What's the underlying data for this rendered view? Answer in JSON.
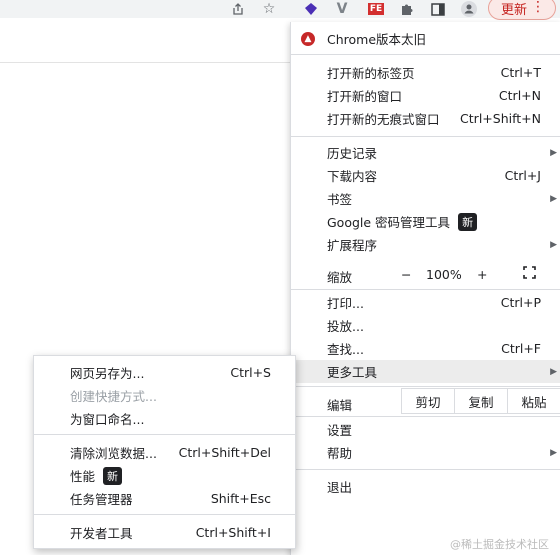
{
  "toolbar": {
    "share_icon": "share-icon",
    "star_icon": "bookmark-star-icon",
    "ext_icons": [
      "extension-purple-diamond-icon",
      "extension-v-icon",
      "extension-fe-icon",
      "extensions-puzzle-icon",
      "side-panel-icon",
      "profile-avatar-icon"
    ],
    "fe_text": "FE",
    "update_label": "更新",
    "menu_icon": "⋮"
  },
  "menu": {
    "chrome_old": "Chrome版本太旧",
    "new_tab": "打开新的标签页",
    "new_tab_sc": "Ctrl+T",
    "new_window": "打开新的窗口",
    "new_window_sc": "Ctrl+N",
    "incognito": "打开新的无痕式窗口",
    "incognito_sc": "Ctrl+Shift+N",
    "history": "历史记录",
    "downloads": "下载内容",
    "downloads_sc": "Ctrl+J",
    "bookmarks": "书签",
    "password_manager": "Google 密码管理工具",
    "new_badge": "新",
    "extensions": "扩展程序",
    "zoom_label": "缩放",
    "zoom_minus": "−",
    "zoom_value": "100%",
    "zoom_plus": "+",
    "print": "打印...",
    "print_sc": "Ctrl+P",
    "cast": "投放...",
    "find": "查找...",
    "find_sc": "Ctrl+F",
    "more_tools": "更多工具",
    "edit_label": "编辑",
    "cut": "剪切",
    "copy": "复制",
    "paste": "粘贴",
    "settings": "设置",
    "help": "帮助",
    "exit": "退出"
  },
  "submenu": {
    "save_page": "网页另存为...",
    "save_page_sc": "Ctrl+S",
    "create_shortcut": "创建快捷方式...",
    "name_window": "为窗口命名...",
    "clear_data": "清除浏览数据...",
    "clear_data_sc": "Ctrl+Shift+Del",
    "performance": "性能",
    "new_badge": "新",
    "task_manager": "任务管理器",
    "task_manager_sc": "Shift+Esc",
    "dev_tools": "开发者工具",
    "dev_tools_sc": "Ctrl+Shift+I"
  },
  "watermark": "@稀土掘金技术社区",
  "colors": {
    "update_red": "#c5221f",
    "menu_hover": "#ececec"
  }
}
